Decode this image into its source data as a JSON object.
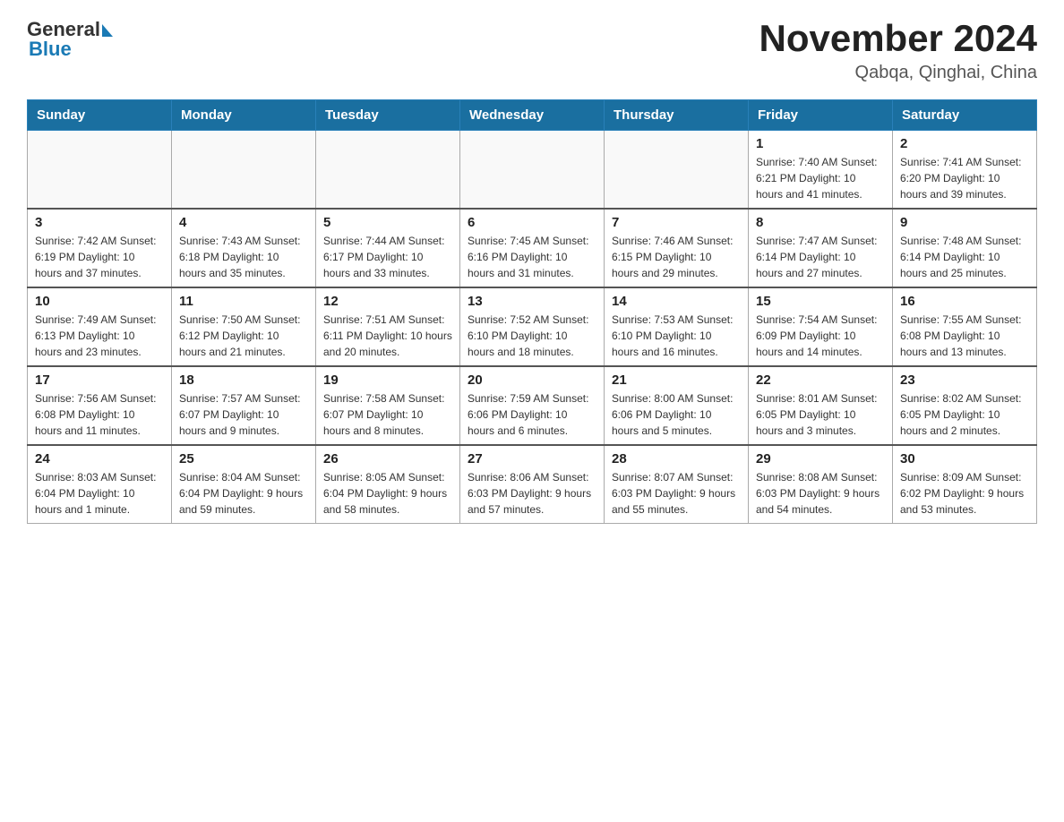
{
  "header": {
    "logo_general": "General",
    "logo_blue": "Blue",
    "title": "November 2024",
    "location": "Qabqa, Qinghai, China"
  },
  "calendar": {
    "days_of_week": [
      "Sunday",
      "Monday",
      "Tuesday",
      "Wednesday",
      "Thursday",
      "Friday",
      "Saturday"
    ],
    "weeks": [
      [
        {
          "day": "",
          "info": ""
        },
        {
          "day": "",
          "info": ""
        },
        {
          "day": "",
          "info": ""
        },
        {
          "day": "",
          "info": ""
        },
        {
          "day": "",
          "info": ""
        },
        {
          "day": "1",
          "info": "Sunrise: 7:40 AM\nSunset: 6:21 PM\nDaylight: 10 hours\nand 41 minutes."
        },
        {
          "day": "2",
          "info": "Sunrise: 7:41 AM\nSunset: 6:20 PM\nDaylight: 10 hours\nand 39 minutes."
        }
      ],
      [
        {
          "day": "3",
          "info": "Sunrise: 7:42 AM\nSunset: 6:19 PM\nDaylight: 10 hours\nand 37 minutes."
        },
        {
          "day": "4",
          "info": "Sunrise: 7:43 AM\nSunset: 6:18 PM\nDaylight: 10 hours\nand 35 minutes."
        },
        {
          "day": "5",
          "info": "Sunrise: 7:44 AM\nSunset: 6:17 PM\nDaylight: 10 hours\nand 33 minutes."
        },
        {
          "day": "6",
          "info": "Sunrise: 7:45 AM\nSunset: 6:16 PM\nDaylight: 10 hours\nand 31 minutes."
        },
        {
          "day": "7",
          "info": "Sunrise: 7:46 AM\nSunset: 6:15 PM\nDaylight: 10 hours\nand 29 minutes."
        },
        {
          "day": "8",
          "info": "Sunrise: 7:47 AM\nSunset: 6:14 PM\nDaylight: 10 hours\nand 27 minutes."
        },
        {
          "day": "9",
          "info": "Sunrise: 7:48 AM\nSunset: 6:14 PM\nDaylight: 10 hours\nand 25 minutes."
        }
      ],
      [
        {
          "day": "10",
          "info": "Sunrise: 7:49 AM\nSunset: 6:13 PM\nDaylight: 10 hours\nand 23 minutes."
        },
        {
          "day": "11",
          "info": "Sunrise: 7:50 AM\nSunset: 6:12 PM\nDaylight: 10 hours\nand 21 minutes."
        },
        {
          "day": "12",
          "info": "Sunrise: 7:51 AM\nSunset: 6:11 PM\nDaylight: 10 hours\nand 20 minutes."
        },
        {
          "day": "13",
          "info": "Sunrise: 7:52 AM\nSunset: 6:10 PM\nDaylight: 10 hours\nand 18 minutes."
        },
        {
          "day": "14",
          "info": "Sunrise: 7:53 AM\nSunset: 6:10 PM\nDaylight: 10 hours\nand 16 minutes."
        },
        {
          "day": "15",
          "info": "Sunrise: 7:54 AM\nSunset: 6:09 PM\nDaylight: 10 hours\nand 14 minutes."
        },
        {
          "day": "16",
          "info": "Sunrise: 7:55 AM\nSunset: 6:08 PM\nDaylight: 10 hours\nand 13 minutes."
        }
      ],
      [
        {
          "day": "17",
          "info": "Sunrise: 7:56 AM\nSunset: 6:08 PM\nDaylight: 10 hours\nand 11 minutes."
        },
        {
          "day": "18",
          "info": "Sunrise: 7:57 AM\nSunset: 6:07 PM\nDaylight: 10 hours\nand 9 minutes."
        },
        {
          "day": "19",
          "info": "Sunrise: 7:58 AM\nSunset: 6:07 PM\nDaylight: 10 hours\nand 8 minutes."
        },
        {
          "day": "20",
          "info": "Sunrise: 7:59 AM\nSunset: 6:06 PM\nDaylight: 10 hours\nand 6 minutes."
        },
        {
          "day": "21",
          "info": "Sunrise: 8:00 AM\nSunset: 6:06 PM\nDaylight: 10 hours\nand 5 minutes."
        },
        {
          "day": "22",
          "info": "Sunrise: 8:01 AM\nSunset: 6:05 PM\nDaylight: 10 hours\nand 3 minutes."
        },
        {
          "day": "23",
          "info": "Sunrise: 8:02 AM\nSunset: 6:05 PM\nDaylight: 10 hours\nand 2 minutes."
        }
      ],
      [
        {
          "day": "24",
          "info": "Sunrise: 8:03 AM\nSunset: 6:04 PM\nDaylight: 10 hours\nand 1 minute."
        },
        {
          "day": "25",
          "info": "Sunrise: 8:04 AM\nSunset: 6:04 PM\nDaylight: 9 hours\nand 59 minutes."
        },
        {
          "day": "26",
          "info": "Sunrise: 8:05 AM\nSunset: 6:04 PM\nDaylight: 9 hours\nand 58 minutes."
        },
        {
          "day": "27",
          "info": "Sunrise: 8:06 AM\nSunset: 6:03 PM\nDaylight: 9 hours\nand 57 minutes."
        },
        {
          "day": "28",
          "info": "Sunrise: 8:07 AM\nSunset: 6:03 PM\nDaylight: 9 hours\nand 55 minutes."
        },
        {
          "day": "29",
          "info": "Sunrise: 8:08 AM\nSunset: 6:03 PM\nDaylight: 9 hours\nand 54 minutes."
        },
        {
          "day": "30",
          "info": "Sunrise: 8:09 AM\nSunset: 6:02 PM\nDaylight: 9 hours\nand 53 minutes."
        }
      ]
    ]
  }
}
